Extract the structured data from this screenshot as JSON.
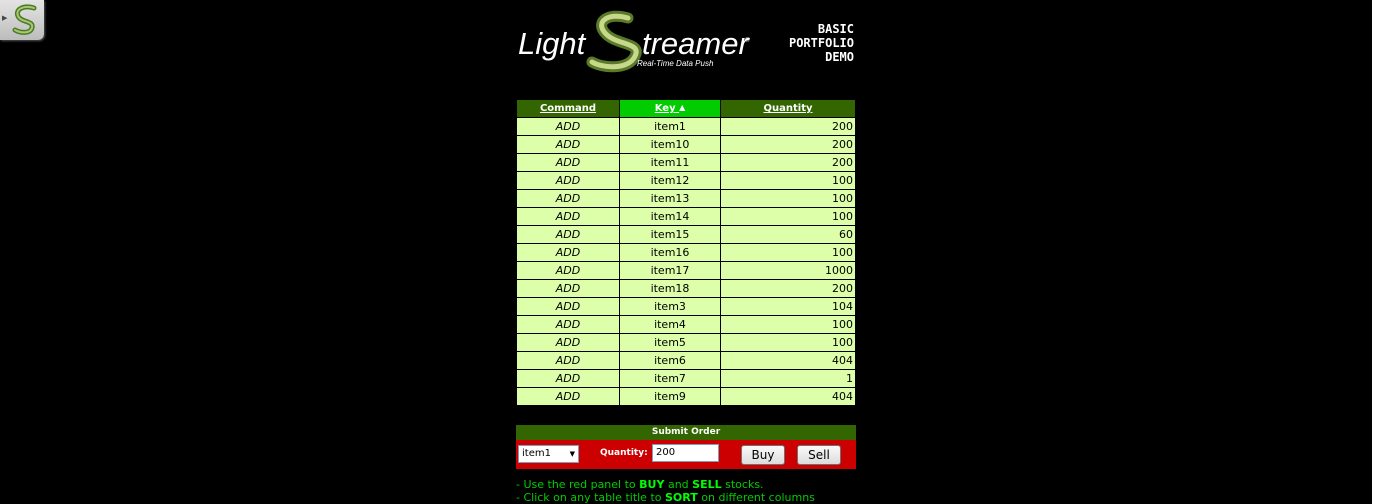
{
  "widget": {
    "icon": "lightstreamer-s-icon"
  },
  "logo": {
    "brand": "LightStreamer",
    "tagline": "Real-Time Data Push"
  },
  "demo_title": {
    "line1": "BASIC",
    "line2": "PORTFOLIO",
    "line3": "DEMO"
  },
  "table": {
    "headers": {
      "command": "Command",
      "key": "Key",
      "quantity": "Quantity"
    },
    "sort_indicator": "▲",
    "rows": [
      {
        "command": "ADD",
        "key": "item1",
        "quantity": "200"
      },
      {
        "command": "ADD",
        "key": "item10",
        "quantity": "200"
      },
      {
        "command": "ADD",
        "key": "item11",
        "quantity": "200"
      },
      {
        "command": "ADD",
        "key": "item12",
        "quantity": "100"
      },
      {
        "command": "ADD",
        "key": "item13",
        "quantity": "100"
      },
      {
        "command": "ADD",
        "key": "item14",
        "quantity": "100"
      },
      {
        "command": "ADD",
        "key": "item15",
        "quantity": "60"
      },
      {
        "command": "ADD",
        "key": "item16",
        "quantity": "100"
      },
      {
        "command": "ADD",
        "key": "item17",
        "quantity": "1000"
      },
      {
        "command": "ADD",
        "key": "item18",
        "quantity": "200"
      },
      {
        "command": "ADD",
        "key": "item3",
        "quantity": "104"
      },
      {
        "command": "ADD",
        "key": "item4",
        "quantity": "100"
      },
      {
        "command": "ADD",
        "key": "item5",
        "quantity": "100"
      },
      {
        "command": "ADD",
        "key": "item6",
        "quantity": "404"
      },
      {
        "command": "ADD",
        "key": "item7",
        "quantity": "1"
      },
      {
        "command": "ADD",
        "key": "item9",
        "quantity": "404"
      }
    ]
  },
  "order": {
    "title": "Submit Order",
    "selected_item": "item1",
    "quantity_label": "Quantity:",
    "quantity_value": "200",
    "buy_label": "Buy",
    "sell_label": "Sell"
  },
  "help": {
    "line1_pre": "- Use the red panel to ",
    "line1_buy": "BUY",
    "line1_mid": " and ",
    "line1_sell": "SELL",
    "line1_post": " stocks.",
    "line2_pre": "- Click on any table title to ",
    "line2_sort": "SORT",
    "line2_post": " on different columns"
  },
  "colors": {
    "background": "#000000",
    "header_green": "#336600",
    "sorted_header": "#00cc00",
    "row_bg": "#ddffaa",
    "order_red": "#cc0000",
    "help_green": "#00cc00"
  }
}
